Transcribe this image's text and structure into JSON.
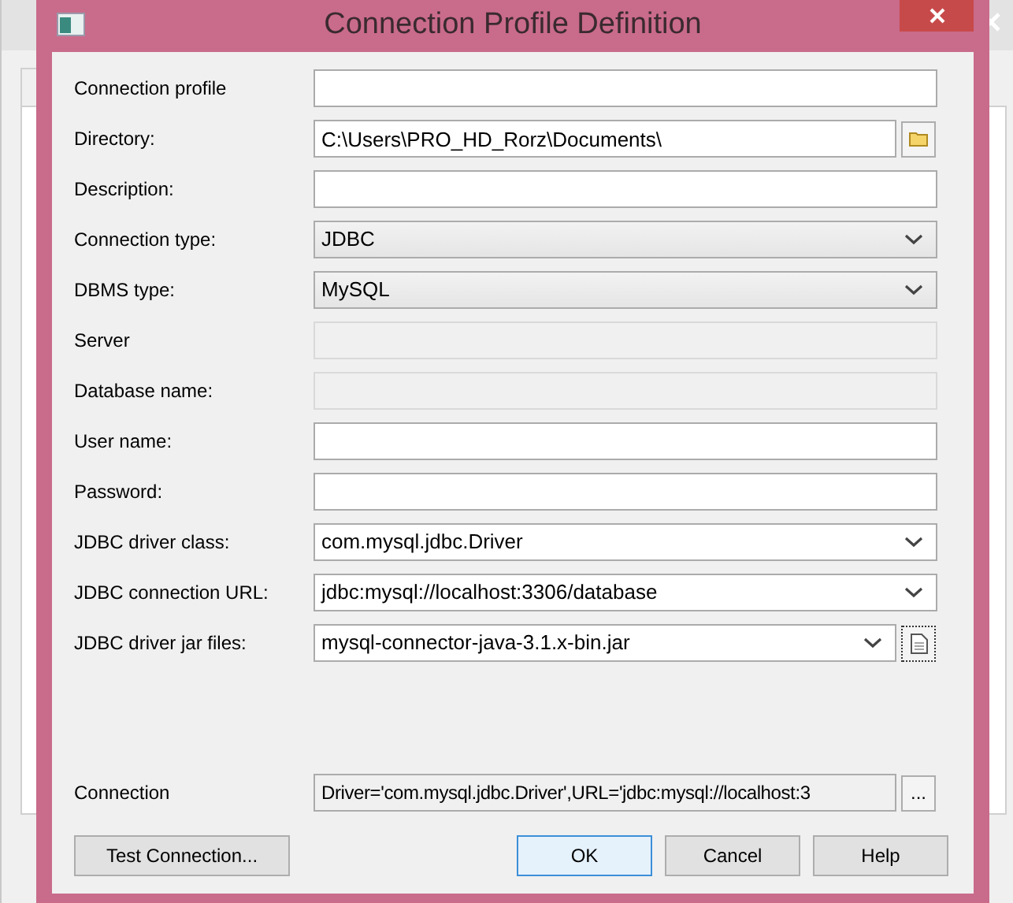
{
  "dialog": {
    "title": "Connection Profile Definition"
  },
  "fields": [
    {
      "label": "Connection profile",
      "kind": "text"
    },
    {
      "label": "Directory:",
      "kind": "text_browse",
      "value": "C:\\Users\\PRO_HD_Rorz\\Documents\\"
    },
    {
      "label": "Description:",
      "kind": "text"
    },
    {
      "label": "Connection type:",
      "kind": "dropdown",
      "value": "JDBC"
    },
    {
      "label": "DBMS type:",
      "kind": "dropdown",
      "value": "MySQL"
    },
    {
      "label": "Server",
      "kind": "disabled"
    },
    {
      "label": "Database name:",
      "kind": "disabled"
    },
    {
      "label": "User name:",
      "kind": "text"
    },
    {
      "label": "Password:",
      "kind": "text"
    },
    {
      "label": "JDBC driver class:",
      "kind": "combo",
      "value": "com.mysql.jdbc.Driver"
    },
    {
      "label": "JDBC connection URL:",
      "kind": "combo",
      "value": "jdbc:mysql://localhost:3306/database"
    },
    {
      "label": "JDBC driver jar files:",
      "kind": "combo_file",
      "value": "mysql-connector-java-3.1.x-bin.jar"
    }
  ],
  "connection": {
    "label": "Connection",
    "value": "Driver='com.mysql.jdbc.Driver',URL='jdbc:mysql://localhost:3",
    "button": "..."
  },
  "buttons": [
    {
      "label": "Test Connection...",
      "default": false
    },
    {
      "label": "OK",
      "default": true
    },
    {
      "label": "Cancel",
      "default": false
    },
    {
      "label": "Help",
      "default": false
    }
  ]
}
